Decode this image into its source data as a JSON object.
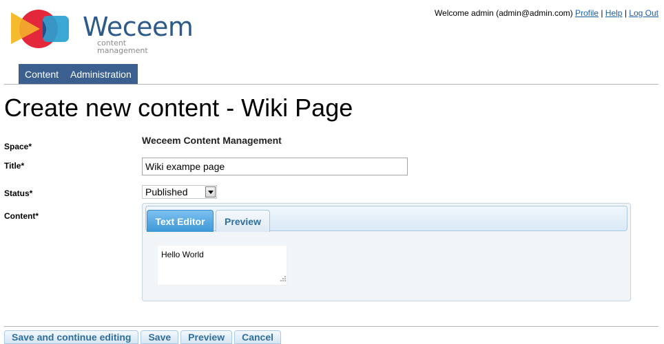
{
  "brand": {
    "name": "Weceem",
    "tagline": "content management"
  },
  "userbar": {
    "welcome": "Welcome admin (admin@admin.com)",
    "links": [
      "Profile",
      "Help",
      "Log Out"
    ],
    "separator": "|"
  },
  "nav": {
    "items": [
      "Content",
      "Administration"
    ]
  },
  "page": {
    "title": "Create new content - Wiki Page"
  },
  "form": {
    "space_label": "Space*",
    "space_value": "Weceem Content Management",
    "title_label": "Title*",
    "title_value": "Wiki exampe page",
    "status_label": "Status*",
    "status_value": "Published",
    "content_label": "Content*",
    "tabs": [
      {
        "label": "Text Editor",
        "active": true
      },
      {
        "label": "Preview",
        "active": false
      }
    ],
    "content_value": "Hello World"
  },
  "actions": {
    "buttons": [
      "Save and continue editing",
      "Save",
      "Preview",
      "Cancel"
    ]
  },
  "colors": {
    "nav_bg": "#3b5f8e",
    "link": "#1d5fa8",
    "tab_active": "#3d98d8",
    "button_text": "#2e6e9e"
  }
}
